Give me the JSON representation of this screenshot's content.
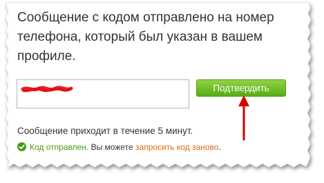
{
  "message": {
    "title": "Сообщение с кодом отправлено на номер телефона, который был указан в вашем профиле."
  },
  "form": {
    "code_input_value": "",
    "confirm_label": "Подтвердить"
  },
  "info": {
    "delivery_time_text": "Сообщение приходит в течение 5 минут."
  },
  "status": {
    "icon": "check-circle-icon",
    "sent_text": "Код отправлен.",
    "middle_text": "Вы можете",
    "resend_link_text": "запросить код заново",
    "end_text": "."
  },
  "colors": {
    "button_green": "#58ac16",
    "sent_green": "#4a9a12",
    "link_orange": "#e06a10",
    "arrow_red": "#d40000"
  }
}
